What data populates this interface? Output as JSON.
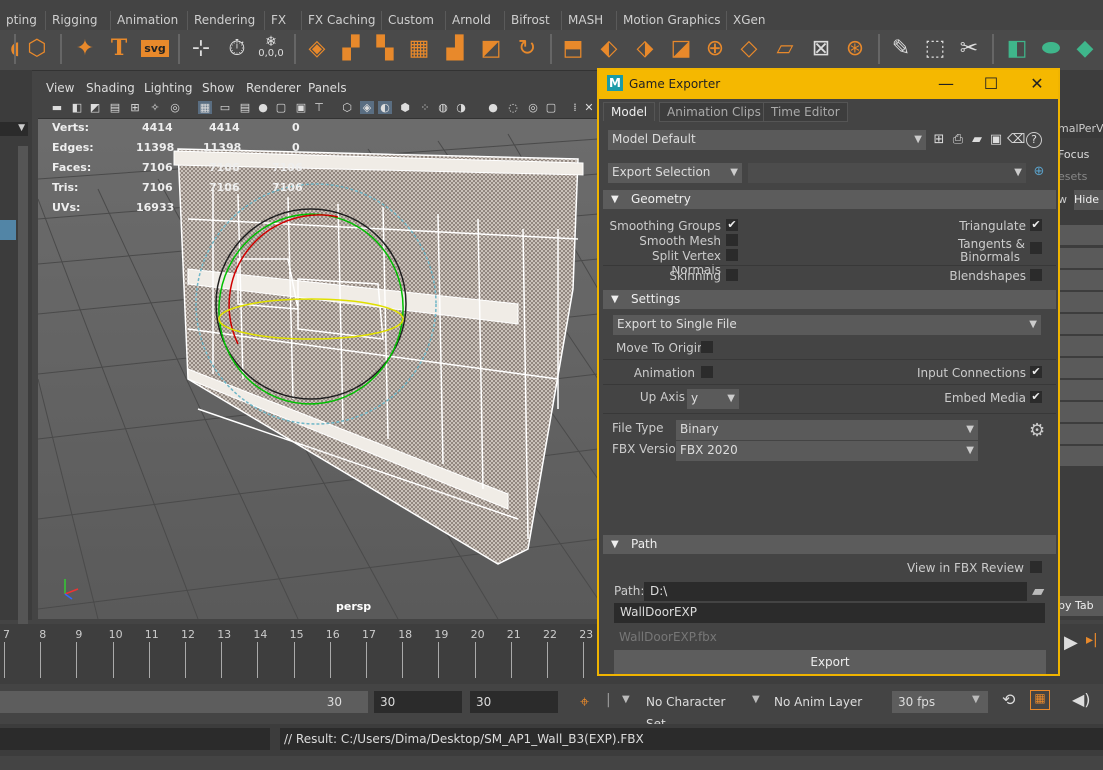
{
  "shelf_tabs": [
    "pting",
    "Rigging",
    "Animation",
    "Rendering",
    "FX",
    "FX Caching",
    "Custom",
    "Arnold",
    "Bifrost",
    "MASH",
    "Motion Graphics",
    "XGen"
  ],
  "shelf_icons": [
    "polyhedron-icon",
    "sparkle-icon",
    "text-icon",
    "svg-icon",
    "sweep-icon",
    "timer-icon",
    "snowflake-icon",
    "cube-icon"
  ],
  "shelf_texts": {
    "text_icon": "T",
    "svg_icon": "svg",
    "snow_label": "0,0,0"
  },
  "viewport": {
    "menu": [
      "View",
      "Shading",
      "Lighting",
      "Show",
      "Renderer",
      "Panels"
    ],
    "stats": [
      {
        "label": "Verts:",
        "a": "4414",
        "b": "4414",
        "c": "0"
      },
      {
        "label": "Edges:",
        "a": "11398",
        "b": "11398",
        "c": "0"
      },
      {
        "label": "Faces:",
        "a": "7106",
        "b": "7106",
        "c": "7106"
      },
      {
        "label": "Tris:",
        "a": "7106",
        "b": "7106",
        "c": "7106"
      },
      {
        "label": "UVs:",
        "a": "16933",
        "b": "",
        "c": ""
      }
    ],
    "camera": "persp"
  },
  "right_panel": {
    "label1": "malPerV",
    "label2": "Focus",
    "label3": "esets",
    "btn_w": "w",
    "btn_hide": "Hide",
    "btn_tab": "py Tab"
  },
  "timeline": {
    "frames": [
      "7",
      "8",
      "9",
      "10",
      "11",
      "12",
      "13",
      "14",
      "15",
      "16",
      "17",
      "18",
      "19",
      "20",
      "21",
      "22",
      "23"
    ]
  },
  "range": {
    "end_value": "30",
    "field2": "30",
    "field3": "30",
    "character_set": "No Character Set",
    "anim_layer": "No Anim Layer",
    "fps": "30 fps"
  },
  "cmdline": {
    "result": "// Result: C:/Users/Dima/Desktop/SM_AP1_Wall_B3(EXP).FBX"
  },
  "exporter": {
    "title": "Game Exporter",
    "logo": "M",
    "tabs": [
      "Model",
      "Animation Clips",
      "Time Editor"
    ],
    "preset": "Model Default",
    "export_mode": "Export Selection",
    "geometry": {
      "header": "Geometry",
      "smoothing_groups": "Smoothing Groups",
      "smooth_mesh": "Smooth Mesh",
      "split_vertex_normals": "Split Vertex Normals",
      "skinning": "Skinning",
      "triangulate": "Triangulate",
      "tangents_line1": "Tangents &",
      "tangents_line2": "Binormals",
      "blendshapes": "Blendshapes"
    },
    "settings": {
      "header": "Settings",
      "export_to": "Export to Single File",
      "move_to_origin": "Move To Origin",
      "animation": "Animation",
      "input_connections": "Input Connections",
      "up_axis_label": "Up Axis",
      "up_axis_value": "y",
      "embed_media": "Embed Media",
      "file_type_label": "File Type",
      "file_type_value": "Binary",
      "fbx_version_label": "FBX Version",
      "fbx_version_value": "FBX 2020"
    },
    "path": {
      "header": "Path",
      "view_in_fbx_review": "View in FBX Review",
      "path_label": "Path:",
      "path_value": "D:\\",
      "file_name": "WallDoorEXP",
      "file_preview": "WallDoorEXP.fbx"
    },
    "export_button": "Export",
    "colors": {
      "accent": "#f5b800"
    }
  }
}
